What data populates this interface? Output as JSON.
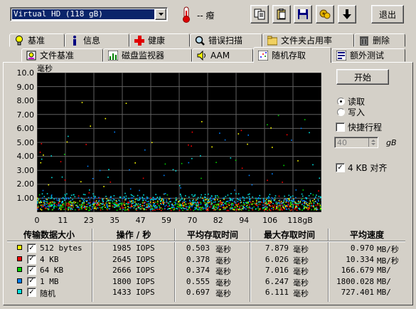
{
  "drive": {
    "selected": "Virtual HD (118 gB)"
  },
  "toolbar": {
    "temperature": "-- 癈",
    "exit_label": "退出"
  },
  "tabs_row1": [
    "基准",
    "信息",
    "健康",
    "错误扫描",
    "文件夹占用率",
    "删除"
  ],
  "tabs_row2": [
    "文件基准",
    "磁盘监视器",
    "AAM",
    "随机存取",
    "额外测试"
  ],
  "active_tab": "随机存取",
  "chart": {
    "y_unit": "毫秒",
    "y_ticks": [
      "10.0",
      "9.00",
      "8.00",
      "7.00",
      "6.00",
      "5.00",
      "4.00",
      "3.00",
      "2.00",
      "1.00"
    ],
    "x_ticks": [
      "0",
      "11",
      "23",
      "35",
      "47",
      "59",
      "70",
      "82",
      "94",
      "106",
      "118gB"
    ]
  },
  "chart_data": {
    "type": "scatter",
    "title": "",
    "ylabel": "毫秒",
    "xlabel": "",
    "x_range": [
      0,
      118
    ],
    "x_unit": "gB",
    "ylim": [
      0,
      10
    ],
    "grid": true,
    "series": [
      {
        "name": "512 bytes",
        "color": "#ffff00",
        "avg_ms": 0.503,
        "max_ms": 7.879
      },
      {
        "name": "4 KB",
        "color": "#ff0000",
        "avg_ms": 0.378,
        "max_ms": 6.026
      },
      {
        "name": "64 KB",
        "color": "#00d000",
        "avg_ms": 0.374,
        "max_ms": 7.016
      },
      {
        "name": "1 MB",
        "color": "#0080ff",
        "avg_ms": 0.555,
        "max_ms": 6.247
      },
      {
        "name": "随机",
        "color": "#00e0e0",
        "avg_ms": 0.697,
        "max_ms": 6.111
      }
    ]
  },
  "controls": {
    "start_label": "开始",
    "read_label": "读取",
    "write_label": "写入",
    "short_stroke_label": "快捷行程",
    "short_stroke_value": "40",
    "short_stroke_unit": "gB",
    "align_label": "4 KB 对齐"
  },
  "table": {
    "headers": [
      "传输数据大小",
      "操作 / 秒",
      "平均存取时间",
      "最大存取时间",
      "平均速度"
    ],
    "rows": [
      {
        "size": "512 bytes",
        "color": "#ffff00",
        "iops": "1985 IOPS",
        "avg": "0.503",
        "avg_unit": "毫秒",
        "max": "7.879",
        "max_unit": "毫秒",
        "speed": "0.970",
        "speed_unit": "MB/秒"
      },
      {
        "size": "4 KB",
        "color": "#ff0000",
        "iops": "2645 IOPS",
        "avg": "0.378",
        "avg_unit": "毫秒",
        "max": "6.026",
        "max_unit": "毫秒",
        "speed": "10.334",
        "speed_unit": "MB/秒"
      },
      {
        "size": "64 KB",
        "color": "#00d000",
        "iops": "2666 IOPS",
        "avg": "0.374",
        "avg_unit": "毫秒",
        "max": "7.016",
        "max_unit": "毫秒",
        "speed": "166.679",
        "speed_unit": "MB/"
      },
      {
        "size": "1 MB",
        "color": "#0080ff",
        "iops": "1800 IOPS",
        "avg": "0.555",
        "avg_unit": "毫秒",
        "max": "6.247",
        "max_unit": "毫秒",
        "speed": "1800.028",
        "speed_unit": "MB/"
      },
      {
        "size": "随机",
        "color": "#00e0e0",
        "iops": "1433 IOPS",
        "avg": "0.697",
        "avg_unit": "毫秒",
        "max": "6.111",
        "max_unit": "毫秒",
        "speed": "727.401",
        "speed_unit": "MB/"
      }
    ]
  }
}
